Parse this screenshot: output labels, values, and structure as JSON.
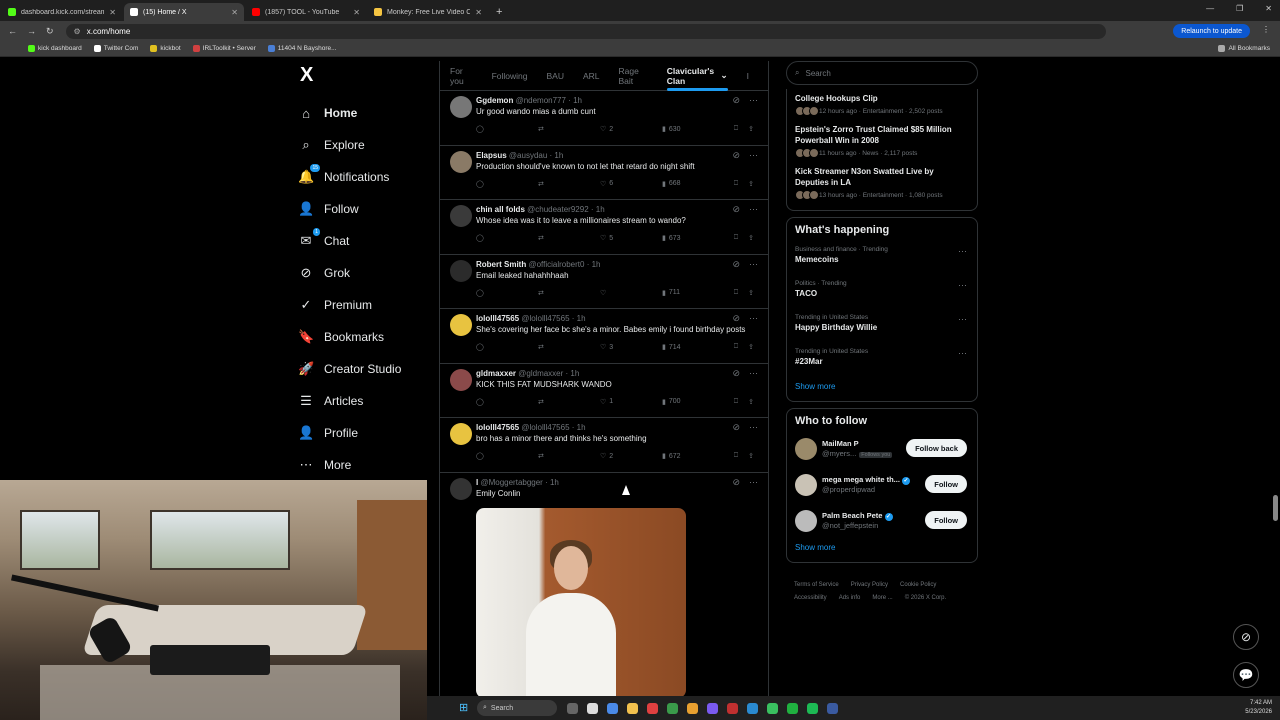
{
  "browser": {
    "tabs": [
      {
        "title": "dashboard.kick.com/stream",
        "color": "#53fc18"
      },
      {
        "title": "(15) Home / X",
        "color": "#ffffff"
      },
      {
        "title": "(1857) TOOL - YouTube",
        "color": "#ff0000"
      },
      {
        "title": "Monkey: Free Live Video C",
        "color": "#f5c542"
      }
    ],
    "url": "x.com/home",
    "relaunch": "Relaunch to update",
    "bookmarks": [
      "kick dashboard",
      "Twitter Com",
      "kickbot",
      "IRLToolkit • Server",
      "11404 N Bayshore..."
    ],
    "all_bookmarks": "All Bookmarks"
  },
  "nav": {
    "logo": "X",
    "items": [
      {
        "label": "Home",
        "icon": "⌂"
      },
      {
        "label": "Explore",
        "icon": "⌕"
      },
      {
        "label": "Notifications",
        "icon": "🔔",
        "badge": "15"
      },
      {
        "label": "Follow",
        "icon": "👤"
      },
      {
        "label": "Chat",
        "icon": "✉",
        "badge": "1"
      },
      {
        "label": "Grok",
        "icon": "⊘"
      },
      {
        "label": "Premium",
        "icon": "✓"
      },
      {
        "label": "Bookmarks",
        "icon": "🔖"
      },
      {
        "label": "Creator Studio",
        "icon": "🚀"
      },
      {
        "label": "Articles",
        "icon": "☰"
      },
      {
        "label": "Profile",
        "icon": "👤"
      },
      {
        "label": "More",
        "icon": "⋯"
      }
    ]
  },
  "feed": {
    "tabs": [
      "For you",
      "Following",
      "BAU",
      "ARL",
      "Rage Bait",
      "Clavicular's Clan",
      "I"
    ],
    "posts": [
      {
        "name": "Ggdemon",
        "handle": "@ndemon777",
        "time": "1h",
        "text": "Ur good wando mias a dumb cunt",
        "likes": "2",
        "views": "630"
      },
      {
        "name": "Elapsus",
        "handle": "@ausydau",
        "time": "1h",
        "text": "Production should've known to not let that retard do night shift",
        "likes": "6",
        "views": "668"
      },
      {
        "name": "chin all folds",
        "handle": "@chudeater9292",
        "time": "1h",
        "text": "Whose idea was it to leave a millionaires stream to wando?",
        "likes": "5",
        "views": "673"
      },
      {
        "name": "Robert Smith",
        "handle": "@officialrobert0",
        "time": "1h",
        "text": "Email leaked hahahhhaah",
        "likes": "",
        "views": "711"
      },
      {
        "name": "lololll47565",
        "handle": "@lololll47565",
        "time": "1h",
        "text": "She's covering her face bc she's a minor. Babes emily i found birthday posts",
        "likes": "3",
        "views": "714"
      },
      {
        "name": "gldmaxxer",
        "handle": "@gldmaxxer",
        "time": "1h",
        "text": "KICK THIS FAT MUDSHARK WANDO",
        "likes": "1",
        "views": "700"
      },
      {
        "name": "lololll47565",
        "handle": "@lololll47565",
        "time": "1h",
        "text": "bro has a minor there and thinks he's something",
        "likes": "2",
        "views": "672"
      }
    ],
    "last_post": {
      "name": "I",
      "handle": "@Moggertabgger",
      "time": "1h",
      "text": "Emily Conlin"
    }
  },
  "sidebar": {
    "search_placeholder": "Search",
    "news": [
      {
        "title": "College Hookups Clip",
        "meta": "12 hours ago · Entertainment · 2,502 posts"
      },
      {
        "title": "Epstein's Zorro Trust Claimed $85 Million Powerball Win in 2008",
        "meta": "11 hours ago · News · 2,117 posts"
      },
      {
        "title": "Kick Streamer N3on Swatted Live by Deputies in LA",
        "meta": "13 hours ago · Entertainment · 1,080 posts"
      }
    ],
    "happening_title": "What's happening",
    "trends": [
      {
        "context": "Business and finance · Trending",
        "name": "Memecoins"
      },
      {
        "context": "Politics · Trending",
        "name": "TACO"
      },
      {
        "context": "Trending in United States",
        "name": "Happy Birthday Willie"
      },
      {
        "context": "Trending in United States",
        "name": "#23Mar"
      }
    ],
    "show_more": "Show more",
    "wtf_title": "Who to follow",
    "who_to_follow": [
      {
        "name": "MailMan P",
        "handle": "@myers...",
        "follows_you": "Follows you",
        "button": "Follow back"
      },
      {
        "name": "mega mega white th...",
        "handle": "@properdipwad",
        "button": "Follow"
      },
      {
        "name": "Palm Beach Pete",
        "handle": "@not_jeffepstein",
        "button": "Follow"
      }
    ],
    "footer": [
      "Terms of Service",
      "Privacy Policy",
      "Cookie Policy",
      "Accessibility",
      "Ads info",
      "More ...",
      "© 2026 X Corp."
    ]
  },
  "taskbar": {
    "search": "Search",
    "time": "7:42 AM",
    "date": "5/23/2026"
  }
}
